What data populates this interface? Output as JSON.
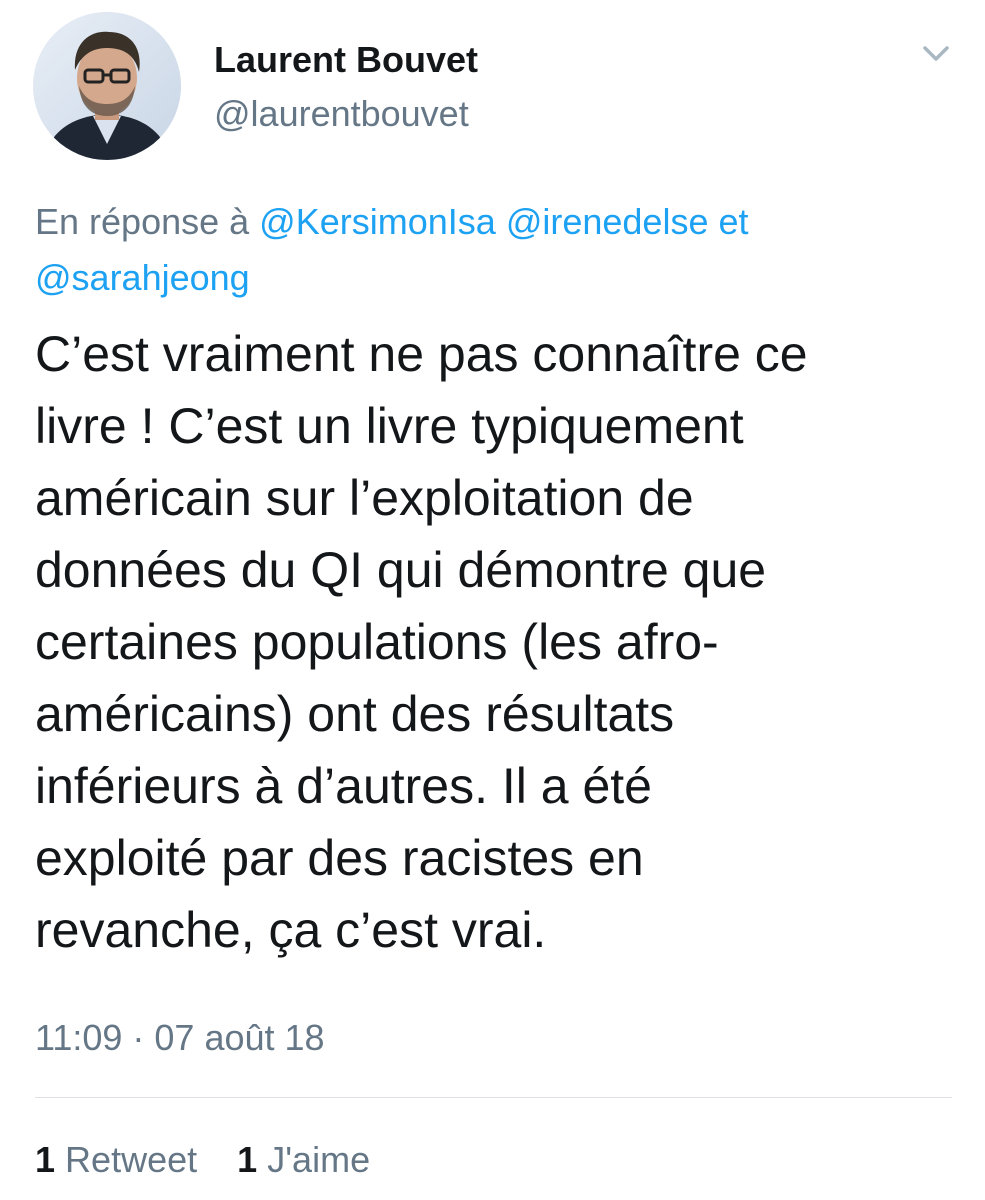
{
  "author": {
    "display_name": "Laurent Bouvet",
    "handle": "@laurentbouvet"
  },
  "icons": {
    "menu": "chevron-down-icon",
    "avatar": "profile-photo"
  },
  "reply": {
    "prefix": "En réponse à",
    "mention_1": "@KersimonIsa",
    "mention_2": "@irenedelse",
    "conjunction": "et",
    "mention_3": "@sarahjeong"
  },
  "tweet": {
    "lines": [
      "C’est vraiment ne pas connaître ce",
      "livre ! C’est un livre typiquement",
      "américain sur l’exploitation de",
      "données du QI qui démontre que",
      "certaines populations (les afro-",
      "américains) ont des résultats",
      "inférieurs à d’autres. Il a été",
      "exploité par des racistes en",
      "revanche, ça c’est vrai."
    ],
    "timestamp": "11:09 · 07 août 18"
  },
  "stats": {
    "retweets_count": "1",
    "retweets_label": "Retweet",
    "likes_count": "1",
    "likes_label": "J'aime"
  },
  "colors": {
    "text": "#14171a",
    "secondary": "#657786",
    "link": "#1da1f2",
    "divider": "#dfe3e8"
  }
}
